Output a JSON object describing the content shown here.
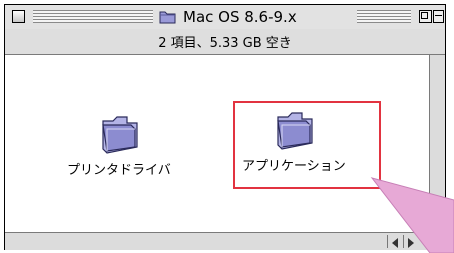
{
  "window": {
    "title": "Mac OS 8.6-9.x",
    "title_icon": "folder-icon"
  },
  "header": {
    "status": "2 項目、5.33 GB 空き"
  },
  "items": [
    {
      "label": "プリンタドライバ",
      "icon": "folder-icon"
    },
    {
      "label": "アプリケーション",
      "icon": "folder-icon",
      "highlighted": true
    }
  ],
  "colors": {
    "highlight": "#e23340",
    "callout": "#e7a9d6",
    "folder": "#9a9ad8"
  }
}
